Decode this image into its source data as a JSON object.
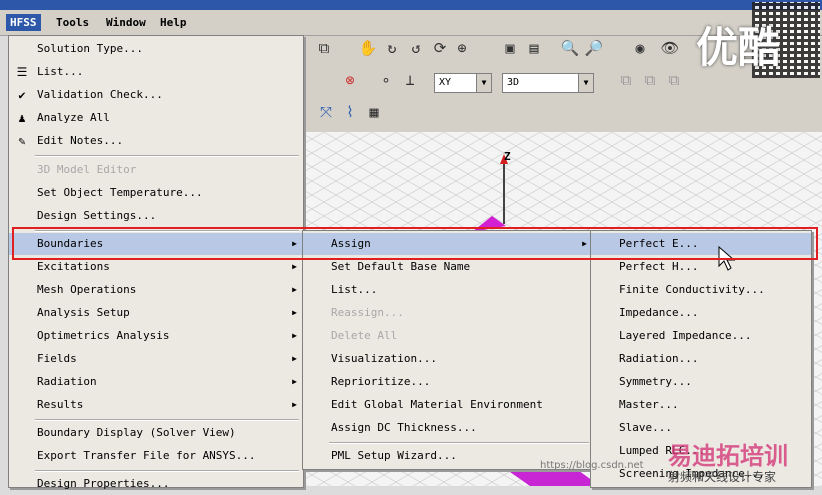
{
  "menubar": {
    "items": [
      {
        "label": "HFSS",
        "active": true
      },
      {
        "label": "Tools",
        "active": false
      },
      {
        "label": "Window",
        "active": false
      },
      {
        "label": "Help",
        "active": false
      }
    ]
  },
  "toolbar": {
    "combo_plane": "XY",
    "combo_mode": "3D"
  },
  "canvas": {
    "axis_label": "Z"
  },
  "hfss_menu": {
    "items": [
      {
        "label": "Solution Type...",
        "icon": "none",
        "disabled": false,
        "submenu": false
      },
      {
        "label": "List...",
        "icon": "list-icon",
        "disabled": false,
        "submenu": false
      },
      {
        "label": "Validation Check...",
        "icon": "validation-check-icon",
        "disabled": false,
        "submenu": false
      },
      {
        "label": "Analyze All",
        "icon": "analyze-icon",
        "disabled": false,
        "submenu": false
      },
      {
        "label": "Edit Notes...",
        "icon": "notes-icon",
        "disabled": false,
        "submenu": false
      },
      {
        "label": "3D Model Editor",
        "icon": "none",
        "disabled": true,
        "submenu": false
      },
      {
        "label": "Set Object Temperature...",
        "icon": "none",
        "disabled": false,
        "submenu": false
      },
      {
        "label": "Design Settings...",
        "icon": "none",
        "disabled": false,
        "submenu": false
      },
      {
        "label": "Boundaries",
        "icon": "none",
        "disabled": false,
        "submenu": true,
        "highlighted": true
      },
      {
        "label": "Excitations",
        "icon": "none",
        "disabled": false,
        "submenu": true
      },
      {
        "label": "Mesh Operations",
        "icon": "none",
        "disabled": false,
        "submenu": true
      },
      {
        "label": "Analysis Setup",
        "icon": "none",
        "disabled": false,
        "submenu": true
      },
      {
        "label": "Optimetrics Analysis",
        "icon": "none",
        "disabled": false,
        "submenu": true
      },
      {
        "label": "Fields",
        "icon": "none",
        "disabled": false,
        "submenu": true
      },
      {
        "label": "Radiation",
        "icon": "none",
        "disabled": false,
        "submenu": true
      },
      {
        "label": "Results",
        "icon": "none",
        "disabled": false,
        "submenu": true
      },
      {
        "label": "Boundary Display (Solver View)",
        "icon": "none",
        "disabled": false,
        "submenu": false
      },
      {
        "label": "Export Transfer File for ANSYS...",
        "icon": "none",
        "disabled": false,
        "submenu": false
      },
      {
        "label": "Design Properties...",
        "icon": "none",
        "disabled": false,
        "submenu": false
      }
    ]
  },
  "boundaries_menu": {
    "items": [
      {
        "label": "Assign",
        "disabled": false,
        "submenu": true,
        "highlighted": true
      },
      {
        "label": "Set Default Base Name",
        "disabled": false,
        "submenu": false
      },
      {
        "label": "List...",
        "disabled": false,
        "submenu": false
      },
      {
        "label": "Reassign...",
        "disabled": true,
        "submenu": false
      },
      {
        "label": "Delete All",
        "disabled": true,
        "submenu": false
      },
      {
        "label": "Visualization...",
        "disabled": false,
        "submenu": false
      },
      {
        "label": "Reprioritize...",
        "disabled": false,
        "submenu": false
      },
      {
        "label": "Edit Global Material Environment",
        "disabled": false,
        "submenu": false
      },
      {
        "label": "Assign DC Thickness...",
        "disabled": false,
        "submenu": false
      },
      {
        "label": "PML Setup Wizard...",
        "disabled": false,
        "submenu": false
      }
    ]
  },
  "assign_menu": {
    "items": [
      {
        "label": "Perfect E...",
        "highlighted": true
      },
      {
        "label": "Perfect H..."
      },
      {
        "label": "Finite Conductivity..."
      },
      {
        "label": "Impedance..."
      },
      {
        "label": "Layered Impedance..."
      },
      {
        "label": "Radiation..."
      },
      {
        "label": "Symmetry..."
      },
      {
        "label": "Master..."
      },
      {
        "label": "Slave..."
      },
      {
        "label": "Lumped RLC..."
      },
      {
        "label": "Screening Impedance..."
      }
    ]
  },
  "watermarks": {
    "youku": "优酷",
    "brand": "易迪拓培训",
    "url": "https://blog.csdn.net",
    "tagline": "射频和天线设计专家"
  },
  "colors": {
    "highlight": "#b9c8e4",
    "selection_box": "#e02020",
    "menu_bg": "#ece9e3",
    "active_menu": "#2d57a8"
  }
}
